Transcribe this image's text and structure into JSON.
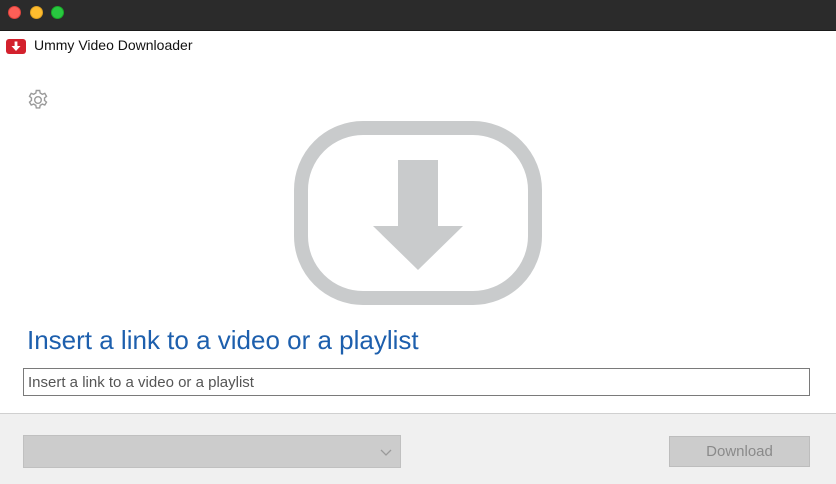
{
  "window": {
    "controls": [
      "close",
      "minimize",
      "maximize"
    ]
  },
  "app": {
    "title": "Ummy Video Downloader",
    "logo_icon": "download-arrow-icon",
    "brand_color": "#d3212d"
  },
  "settings": {
    "icon": "gear-icon"
  },
  "hero": {
    "icon": "video-download-icon",
    "icon_color": "#c9cbcc"
  },
  "main": {
    "headline": "Insert a link to a video or a playlist",
    "headline_color": "#1d5fad",
    "url_input": {
      "value": "",
      "placeholder": "Insert a link to a video or a playlist"
    }
  },
  "footer": {
    "format_select": {
      "selected": "",
      "icon": "chevron-down-icon"
    },
    "download_label": "Download"
  }
}
